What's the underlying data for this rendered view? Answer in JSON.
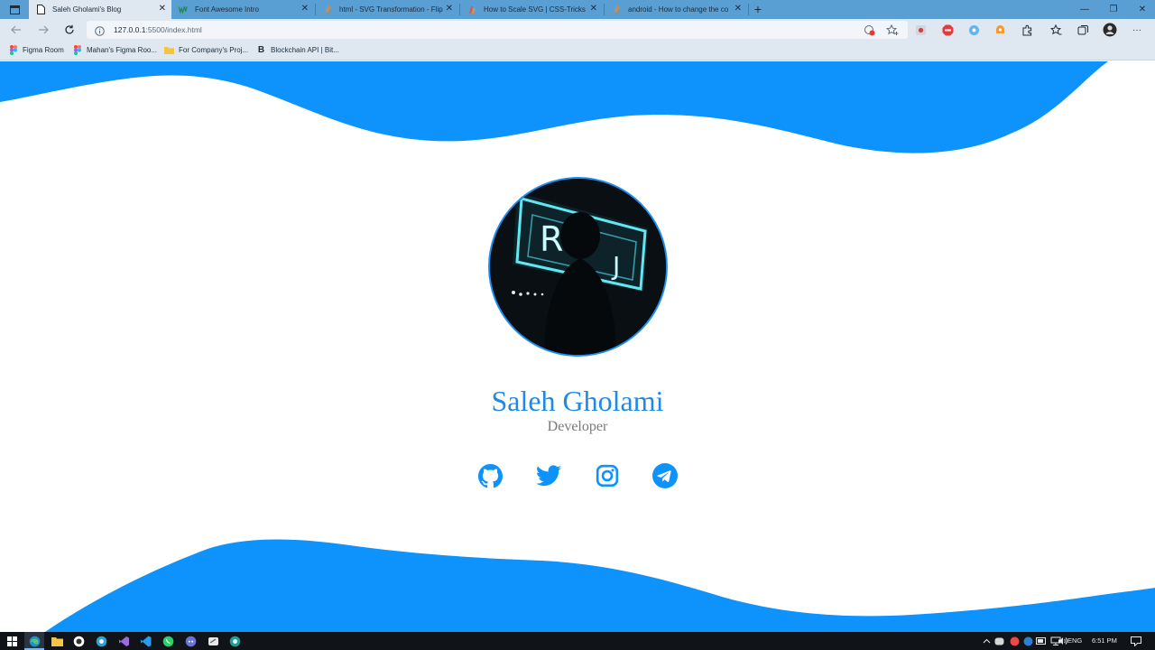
{
  "browser": {
    "tabs": [
      {
        "title": "Saleh Gholami's Blog",
        "active": true
      },
      {
        "title": "Font Awesome Intro",
        "active": false
      },
      {
        "title": "html - SVG Transformation - Flip",
        "active": false
      },
      {
        "title": "How to Scale SVG | CSS-Tricks",
        "active": false
      },
      {
        "title": "android - How to change the co",
        "active": false
      }
    ],
    "close_glyph": "✕",
    "new_tab_glyph": "+",
    "window_controls": {
      "minimize": "—",
      "restore": "❐",
      "close": "✕"
    },
    "address": {
      "host": "127.0.0.1",
      "path": ":5500/index.html"
    },
    "menu_glyph": "···",
    "bookmarks": [
      {
        "label": "Figma Room",
        "icon": "figma-icon"
      },
      {
        "label": "Mahan's Figma Roo...",
        "icon": "figma-icon"
      },
      {
        "label": "For Company's Proj...",
        "icon": "folder-icon"
      },
      {
        "label": "Blockchain API | Bit...",
        "icon": "bitcoin-b-icon"
      }
    ]
  },
  "page": {
    "name": "Saleh Gholami",
    "role": "Developer",
    "socials": [
      {
        "name": "github",
        "icon": "github-icon"
      },
      {
        "name": "twitter",
        "icon": "twitter-icon"
      },
      {
        "name": "instagram",
        "icon": "instagram-icon"
      },
      {
        "name": "telegram",
        "icon": "telegram-icon"
      }
    ],
    "colors": {
      "wave": "#0d93fb",
      "accent": "#1e8ae6",
      "role": "#7a7a7a"
    }
  },
  "taskbar": {
    "tray": {
      "language": "ENG",
      "time": "6:51 PM"
    }
  }
}
